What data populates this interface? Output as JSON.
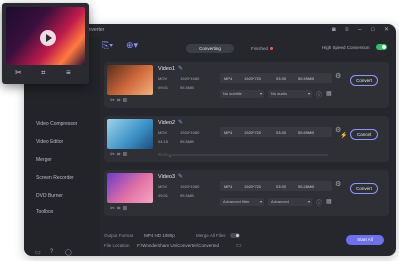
{
  "app": {
    "title": "onverter"
  },
  "tabs": {
    "converting": "Converting",
    "finished": "Finished"
  },
  "high_speed": {
    "label": "High Speed Conversion",
    "enabled": true
  },
  "sidebar": {
    "items": [
      {
        "label": "Video Compressor"
      },
      {
        "label": "Video Editor"
      },
      {
        "label": "Merger"
      },
      {
        "label": "Screen Recorder"
      },
      {
        "label": "DVD Burner"
      },
      {
        "label": "Toolbox"
      }
    ]
  },
  "videos": [
    {
      "name": "Video1",
      "src_format": "MOV",
      "src_res": "1920*1080",
      "src_dur": "09:01",
      "src_size": "95.5MB",
      "out_format": "MP4",
      "out_res": "1920*720",
      "out_dur": "03:30",
      "out_size": "55.59MB",
      "subtitle": "No subtitle",
      "audio": "No audio",
      "action": "Convert",
      "status": ""
    },
    {
      "name": "Video2",
      "src_format": "MOV",
      "src_res": "1920*1080",
      "src_dur": "04:15",
      "src_size": "95.5MB",
      "out_format": "MP4",
      "out_res": "1920*720",
      "out_dur": "03:30",
      "out_size": "55.59MB",
      "subtitle": "",
      "audio": "",
      "action": "Cancel",
      "status": "Waiting..."
    },
    {
      "name": "Video3",
      "src_format": "MOV",
      "src_res": "1920*1080",
      "src_dur": "09:01",
      "src_size": "95.5MB",
      "out_format": "MP4",
      "out_res": "1920*720",
      "out_dur": "03:30",
      "out_size": "55.28MB",
      "subtitle": "Advanced filter",
      "audio": "Advanced",
      "action": "Convert",
      "status": ""
    }
  ],
  "footer": {
    "output_format_label": "Output Format",
    "output_format_value": "MP4 HD 1080p",
    "merge_label": "Merge All Files",
    "file_location_label": "File Location",
    "file_location_value": "F:\\Wondershare UniConverter\\Converted",
    "start_all": "Start All"
  },
  "colors": {
    "accent": "#6f6ff2",
    "toggle_on": "#2fc567",
    "status_red": "#ff4f5e"
  },
  "icons": {
    "toolbar": [
      "add-files-icon",
      "add-more-icon"
    ],
    "thumb_tools": [
      "cut-icon",
      "crop-icon",
      "effects-icon"
    ],
    "popup_tools": [
      "scissors-icon",
      "crop-icon",
      "menu-icon"
    ]
  }
}
